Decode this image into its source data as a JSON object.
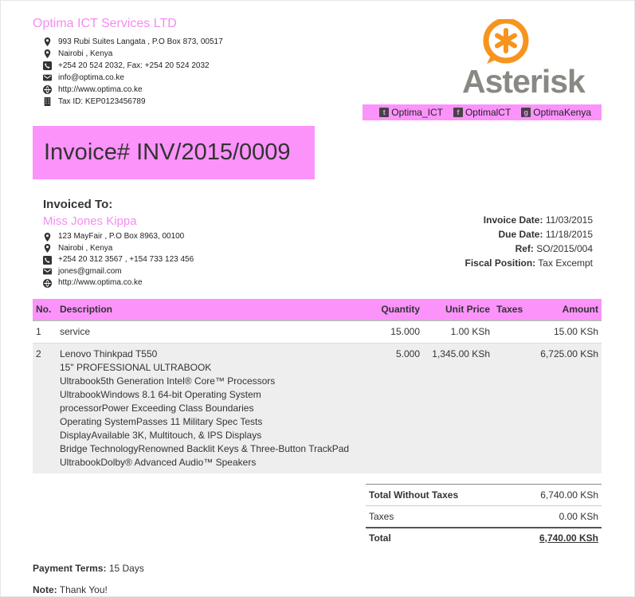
{
  "company": {
    "name": "Optima ICT Services LTD",
    "address_line1": "993 Rubi Suites Langata , P.O Box 873, 00517",
    "address_line2": " Nairobi , Kenya",
    "phone": "+254 20 524 2032, Fax: +254 20 524 2032",
    "email": "info@optima.co.ke",
    "website": "http://www.optima.co.ke",
    "tax_id": "Tax ID: KEP0123456789"
  },
  "logo": {
    "wordmark": "Asterisk",
    "accent_color": "#f7941d",
    "text_color": "#8a8883"
  },
  "social": [
    {
      "icon": "twitter-icon",
      "label": "Optima_ICT"
    },
    {
      "icon": "facebook-icon",
      "label": "OptimalCT"
    },
    {
      "icon": "google-plus-icon",
      "label": "OptimaKenya"
    }
  ],
  "colors": {
    "accent": "#fb93fb",
    "accent_text": "#f58cf0"
  },
  "invoice": {
    "title": "Invoice# INV/2015/0009"
  },
  "customer": {
    "heading": "Invoiced To:",
    "name": "Miss Jones Kippa",
    "address_line1": "123 MayFair , P.O Box 8963, 00100",
    "address_line2": " Nairobi , Kenya",
    "phone": "+254 20 312 3567 , +154 733 123 456",
    "email": "jones@gmail.com",
    "website": "http://www.optima.co.ke"
  },
  "meta": {
    "invoice_date_label": "Invoice Date:",
    "invoice_date": " 11/03/2015",
    "due_date_label": "Due Date:",
    "due_date": " 11/18/2015",
    "ref_label": "Ref:",
    "ref": " SO/2015/004",
    "fiscal_label": "Fiscal Position:",
    "fiscal": " Tax Excempt"
  },
  "table": {
    "headers": {
      "no": "No.",
      "description": "Description",
      "quantity": "Quantity",
      "unit_price": "Unit Price",
      "taxes": "Taxes",
      "amount": "Amount"
    },
    "rows": [
      {
        "no": "1",
        "description": [
          "service"
        ],
        "quantity": "15.000",
        "unit_price": "1.00 KSh",
        "taxes": "",
        "amount": "15.00 KSh"
      },
      {
        "no": "2",
        "description": [
          "Lenovo Thinkpad T550",
          "15\" PROFESSIONAL ULTRABOOK",
          "Ultrabook5th Generation Intel® Core™ Processors",
          "UltrabookWindows 8.1 64-bit Operating System",
          "processorPower Exceeding Class Boundaries",
          "Operating SystemPasses 11 Military Spec Tests",
          "DisplayAvailable 3K, Multitouch, & IPS Displays",
          "Bridge TechnologyRenowned Backlit Keys & Three-Button TrackPad",
          "UltrabookDolby® Advanced Audio™ Speakers"
        ],
        "quantity": "5.000",
        "unit_price": "1,345.00 KSh",
        "taxes": "",
        "amount": "6,725.00 KSh"
      }
    ]
  },
  "totals": {
    "without_taxes_label": "Total Without Taxes",
    "without_taxes": "6,740.00 KSh",
    "taxes_label": "Taxes",
    "taxes": "0.00 KSh",
    "total_label": "Total",
    "total": "6,740.00 KSh"
  },
  "footer": {
    "payment_terms_label": "Payment Terms:",
    "payment_terms": " 15 Days",
    "note_label": "Note:",
    "note": " Thank You!"
  }
}
